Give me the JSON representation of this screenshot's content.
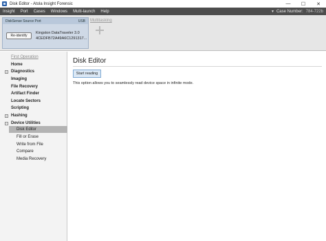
{
  "window": {
    "title": "Disk Editor - Atola Insight Forensic",
    "controls": {
      "minimize": "—",
      "maximize": "☐",
      "close": "✕"
    }
  },
  "menu": {
    "items": [
      "Insight",
      "Port",
      "Cases",
      "Windows",
      "Multi-launch",
      "Help"
    ],
    "case_label": "Case Number:",
    "case_value": "784-722b"
  },
  "device": {
    "port_label": "DiskSense Source Port",
    "interface": "USB",
    "identify_label": "Re-identify",
    "name": "Kingston DataTraveler 3.0",
    "serial": "4CEDFB72A49A6C1291317...",
    "multitasking_label": "Multitasking"
  },
  "sidebar": {
    "first_operation": "First Operation",
    "items": [
      {
        "label": "Home",
        "expandable": false
      },
      {
        "label": "Diagnostics",
        "expandable": true
      },
      {
        "label": "Imaging",
        "expandable": false
      },
      {
        "label": "File Recovery",
        "expandable": false
      },
      {
        "label": "Artifact Finder",
        "expandable": false
      },
      {
        "label": "Locate Sectors",
        "expandable": false
      },
      {
        "label": "Scripting",
        "expandable": false
      },
      {
        "label": "Hashing",
        "expandable": true
      },
      {
        "label": "Device Utilities",
        "expandable": true
      }
    ],
    "sub_items": [
      "Disk Editor",
      "Fill or Erase",
      "Write from File",
      "Compare",
      "Media Recovery"
    ],
    "active_sub": "Disk Editor"
  },
  "main": {
    "title": "Disk Editor",
    "start_button": "Start reading",
    "description": "This option allows you to seamlessly read device space in infinite mode."
  }
}
